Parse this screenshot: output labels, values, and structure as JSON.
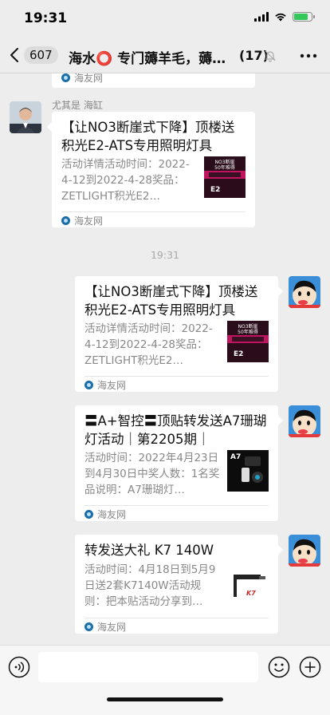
{
  "status": {
    "time": "19:31"
  },
  "header": {
    "back_count": "607",
    "title": "海水⭕ 专门薅羊毛，薅…",
    "member_count": "(17)"
  },
  "partial_card": {
    "source": "海友网"
  },
  "messages": [
    {
      "sender": "尤其是 海缸",
      "title": "【让NO3断崖式下降】顶楼送积光E2-ATS专用照明灯具",
      "desc": "活动详情活动时间：2022-4-12到2022-4-28奖品：ZETLIGHT积光E2…",
      "source": "海友网",
      "thumb_caption": "NO3断崖 50年难得"
    }
  ],
  "timestamp": "19:31",
  "my_messages": [
    {
      "title": "【让NO3断崖式下降】顶楼送积光E2-ATS专用照明灯具",
      "desc": "活动详情活动时间：2022-4-12到2022-4-28奖品：ZETLIGHT积光E2…",
      "source": "海友网",
      "thumb_caption": "NO3断崖 50年难得"
    },
    {
      "title": "〓A+智控〓顶贴转发送A7珊瑚灯活动｜第2205期｜",
      "desc": "活动时间：2022年4月23日到4月30日中奖人数：1名奖品说明：A7珊瑚灯…",
      "source": "海友网",
      "thumb_caption": "A7"
    },
    {
      "title": "转发送大礼 K7 140W",
      "desc": "活动时间：4月18日到5月9日送2套K7140W活动规则：把本贴活动分享到…",
      "source": "海友网",
      "thumb_caption": "K7"
    }
  ],
  "colors": {
    "background": "#ededed",
    "bubble": "#ffffff",
    "source_icon": "#1a6fa8"
  },
  "icons": [
    "back-chevron-icon",
    "mute-icon",
    "more-icon",
    "voice-icon",
    "emoji-icon",
    "plus-icon"
  ]
}
